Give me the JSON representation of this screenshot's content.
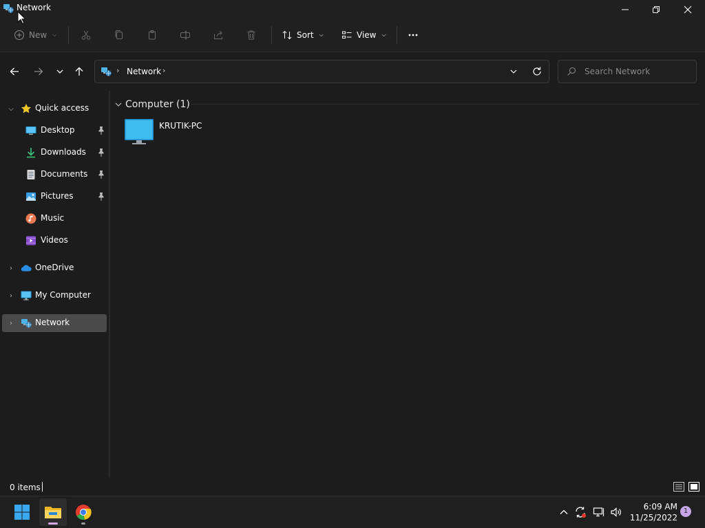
{
  "window": {
    "title": "Network"
  },
  "toolbar": {
    "new_label": "New",
    "sort_label": "Sort",
    "view_label": "View"
  },
  "address": {
    "location": "Network"
  },
  "search": {
    "placeholder": "Search Network"
  },
  "sidebar": {
    "quick_access": "Quick access",
    "items": [
      {
        "label": "Desktop",
        "icon": "desktop-icon",
        "pinned": true
      },
      {
        "label": "Downloads",
        "icon": "download-icon",
        "pinned": true
      },
      {
        "label": "Documents",
        "icon": "document-icon",
        "pinned": true
      },
      {
        "label": "Pictures",
        "icon": "pictures-icon",
        "pinned": true
      },
      {
        "label": "Music",
        "icon": "music-icon",
        "pinned": false
      },
      {
        "label": "Videos",
        "icon": "videos-icon",
        "pinned": false
      }
    ],
    "onedrive": "OneDrive",
    "my_computer": "My Computer",
    "network": "Network"
  },
  "content": {
    "group_label": "Computer (1)",
    "computers": [
      {
        "name": "KRUTIK-PC"
      }
    ]
  },
  "status": {
    "items_count": "0 items"
  },
  "taskbar": {
    "time": "6:09 AM",
    "date": "11/25/2022",
    "notification_count": "1"
  },
  "colors": {
    "background": "#1c1c1c",
    "selected": "#4a4a4a",
    "accent": "#c7a6e8"
  }
}
